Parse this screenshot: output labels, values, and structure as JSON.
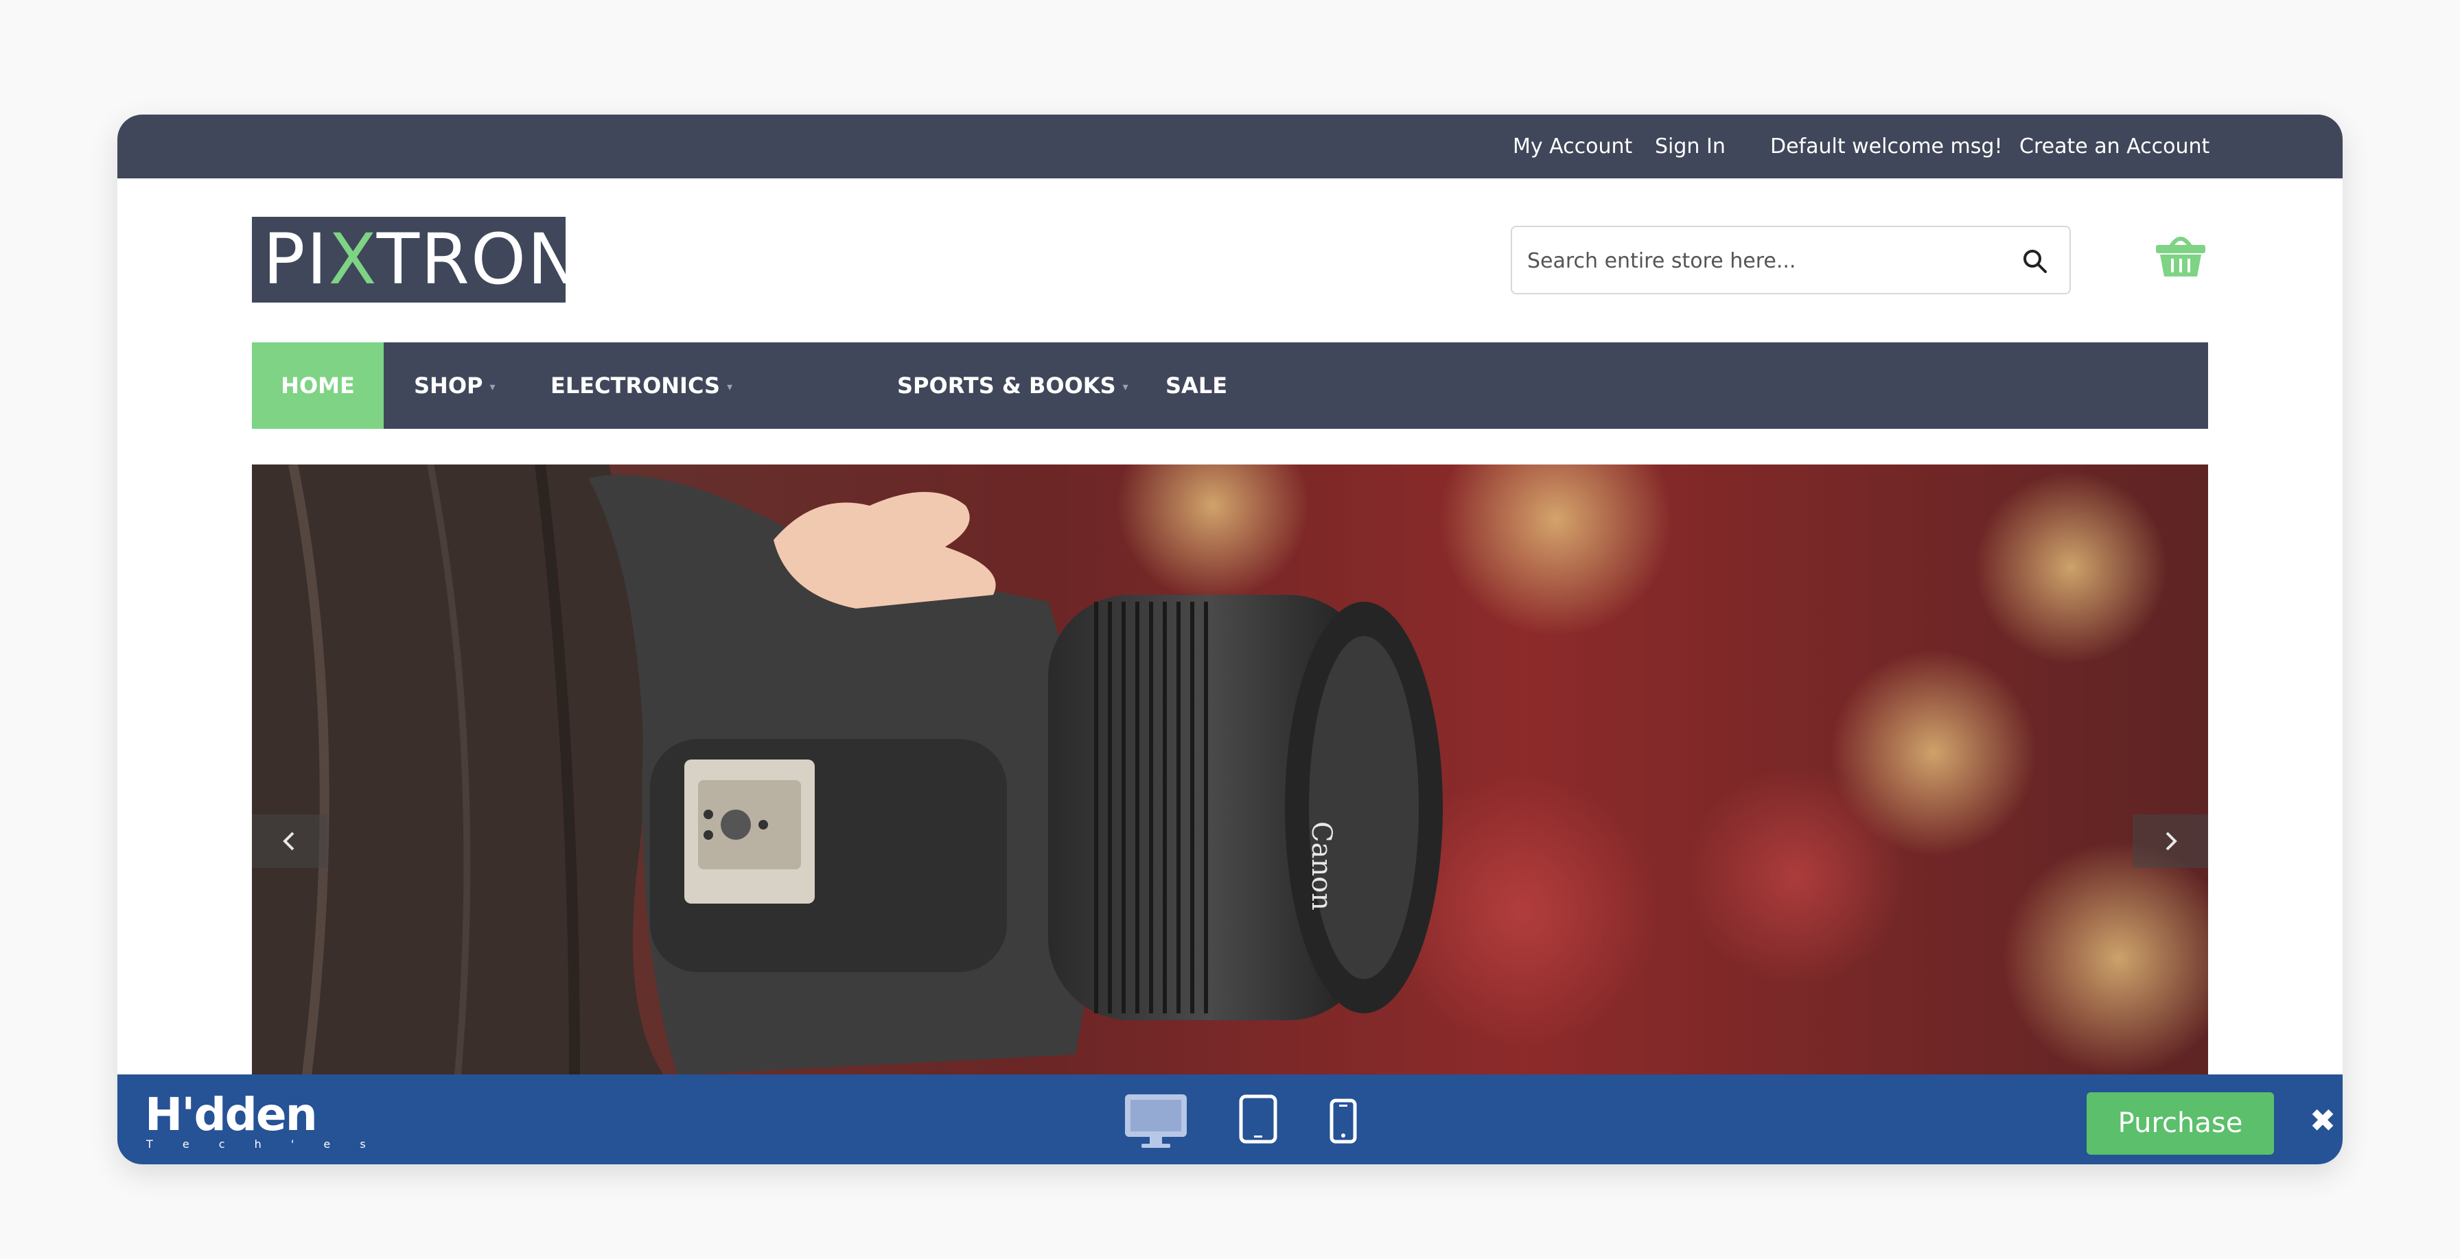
{
  "topbar": {
    "links": [
      "My Account",
      "Sign In",
      "Default welcome msg!",
      "Create an Account"
    ]
  },
  "logo": {
    "text_left": "PI",
    "text_x": "X",
    "text_right": "TRON"
  },
  "search": {
    "placeholder": "Search entire store here...",
    "icon": "search-icon"
  },
  "cart": {
    "icon": "basket-icon",
    "accent": "#7ed385"
  },
  "nav": {
    "items": [
      {
        "label": "HOME",
        "active": true
      },
      {
        "label": "SHOP",
        "has_dropdown": true
      },
      {
        "label": "ELECTRONICS",
        "has_dropdown": true
      },
      {
        "label": "SPORTS & BOOKS",
        "has_dropdown": true
      },
      {
        "label": "SALE"
      }
    ]
  },
  "hero": {
    "prev_icon": "chevron-left-icon",
    "next_icon": "chevron-right-icon",
    "camera_brand": "Canon"
  },
  "bottombar": {
    "brand": {
      "main": "H'dden",
      "sub": "T e c h ' e s"
    },
    "devices": [
      "desktop-icon",
      "tablet-icon",
      "mobile-icon"
    ],
    "purchase_label": "Purchase",
    "close_label": "✖"
  },
  "colors": {
    "dark": "#40475a",
    "accent_green": "#7ed385",
    "bottom_blue": "#265296",
    "purchase_green": "#5bbf6b"
  }
}
